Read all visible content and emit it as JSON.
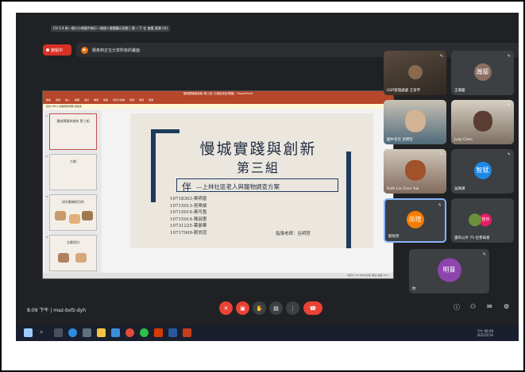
{
  "tooltip": "CH 1-4 新一個小小視窗中執行一個個人電腦顯示投影 | 請 一下 在 查看 資源 (外)",
  "recording": {
    "label": "錄製中"
  },
  "presenting": {
    "text": "剛來到正在分享所有的畫面"
  },
  "ppt": {
    "window_title": "慢城實踐與創新-第三組 (已儲存到此電腦) - PowerPoint",
    "ribbon": [
      "檔案",
      "常用",
      "插入",
      "繪圖",
      "設計",
      "轉場",
      "動畫",
      "投影片放映",
      "校閱",
      "檢視",
      "說明"
    ],
    "notice": "您的 Office 授權即將到期 請啟用",
    "thumbs": [
      {
        "num": "1",
        "label": "慢城實踐與創新 第三組"
      },
      {
        "num": "2",
        "label": "大綱"
      },
      {
        "num": "3",
        "label": "研究動機與目的"
      },
      {
        "num": "4",
        "label": "文獻探討"
      }
    ],
    "slide": {
      "title1": "慢城實踐與創新",
      "title2": "第三組",
      "subtitle_big": "伴",
      "subtitle_small": "—上林社區老人與寵物調查方案",
      "ids": [
        "10718303-黃明普",
        "10715013-吳珮禎",
        "10715018-黃可盈",
        "10715014-陳淑惠",
        "10731225-葉晏華",
        "10717009-劉尚瑄"
      ],
      "advisor": "指導老師：呂明哲"
    },
    "status": "投影片 1/9   中文(台灣)   備註   註解   70%"
  },
  "participants": [
    {
      "name": "USR管理處處 王晉宇",
      "type": "video",
      "color": "#6b5a4a"
    },
    {
      "name": "王瀚鋆",
      "type": "avatar",
      "letter": "瀚鋆",
      "color": "#8d6e63"
    },
    {
      "name": "國中名社 呂明哲",
      "type": "video",
      "color": "#4e6a79"
    },
    {
      "name": "Judy Chen",
      "type": "video",
      "color": "#7b6f61"
    },
    {
      "name": "Ruth Lin Chen Yuk",
      "type": "video",
      "color": "#826b5d"
    },
    {
      "name": "吳珮禎",
      "type": "avatar",
      "letter": "智斌",
      "color": "#1e88e5"
    },
    {
      "name": "劉尚瑄",
      "type": "avatar",
      "letter": "尚瑄",
      "color": "#f57c00",
      "active": true
    },
    {
      "name": "還有以外 75 位參與者",
      "type": "group",
      "letter": "佳伶",
      "color": "#e91e63"
    },
    {
      "name": "你",
      "type": "avatar",
      "letter": "明普",
      "color": "#8e44ad"
    }
  ],
  "meeting": {
    "time": "8:09 下午",
    "code": "maz-bxfz-dyh"
  },
  "clock": {
    "time": "下午 08:09",
    "date": "2021/5/16"
  }
}
